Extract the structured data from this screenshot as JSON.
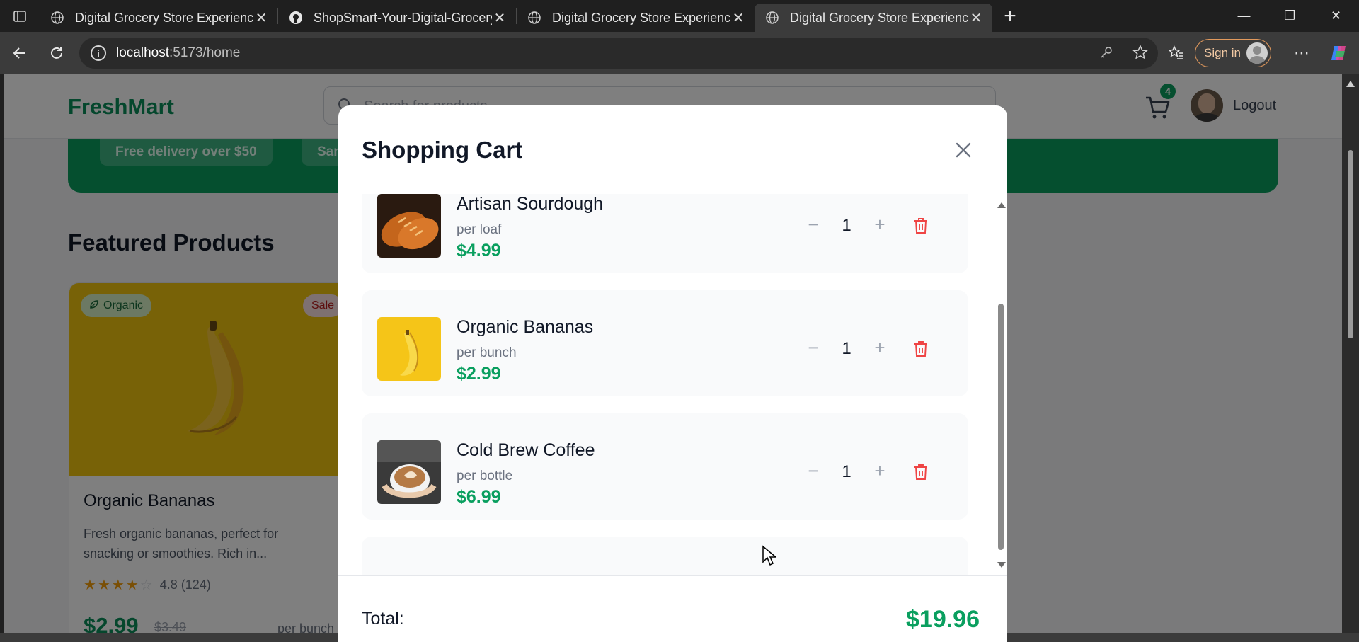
{
  "browser": {
    "tabs": [
      {
        "title": "Digital Grocery Store Experience",
        "icon": "globe-icon",
        "active": false
      },
      {
        "title": "ShopSmart-Your-Digital-Grocery-",
        "icon": "github-icon",
        "active": false
      },
      {
        "title": "Digital Grocery Store Experience",
        "icon": "globe-icon",
        "active": false
      },
      {
        "title": "Digital Grocery Store Experience",
        "icon": "globe-icon",
        "active": true
      }
    ],
    "url_host": "localhost",
    "url_rest": ":5173/home",
    "sign_in_label": "Sign in"
  },
  "site": {
    "logo": "FreshMart",
    "search_placeholder": "Search for products...",
    "cart_count": "4",
    "logout_label": "Logout",
    "hero_pills": [
      "Free delivery over $50",
      "Same"
    ],
    "featured_title": "Featured Products",
    "product_card": {
      "badge_organic": "Organic",
      "badge_sale": "Sale",
      "name": "Organic Bananas",
      "description": "Fresh organic bananas, perfect for snacking or smoothies. Rich in...",
      "rating_text": "4.8 (124)",
      "rating_value": 4.8,
      "price": "$2.99",
      "old_price": "$3.49",
      "unit": "per bunch"
    }
  },
  "cart": {
    "title": "Shopping Cart",
    "items": [
      {
        "name": "Artisan Sourdough",
        "unit": "per loaf",
        "price": "$4.99",
        "qty": "1"
      },
      {
        "name": "Organic Bananas",
        "unit": "per bunch",
        "price": "$2.99",
        "qty": "1"
      },
      {
        "name": "Cold Brew Coffee",
        "unit": "per bottle",
        "price": "$6.99",
        "qty": "1"
      }
    ],
    "total_label": "Total:",
    "total_value": "$19.96"
  },
  "colors": {
    "brand_green": "#0a9f5f",
    "delete_red": "#ef4444",
    "banana_yellow": "#f1c40f"
  }
}
